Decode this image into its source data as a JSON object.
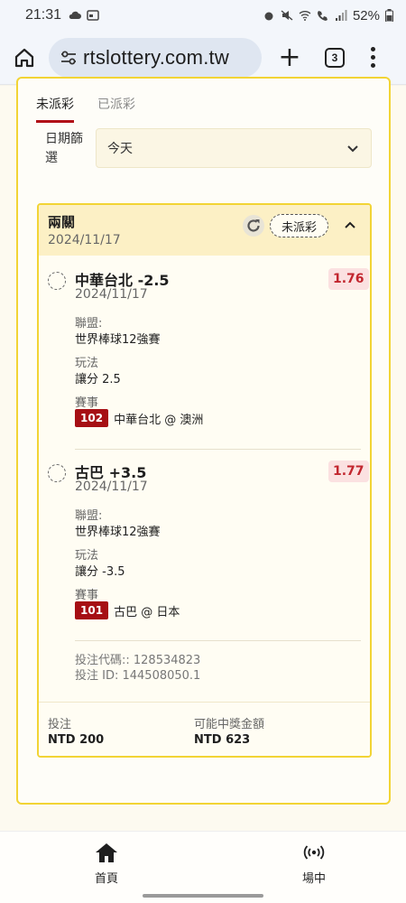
{
  "status_bar": {
    "time": "21:31",
    "battery": "52%"
  },
  "browser": {
    "url": "rtslottery.com.tw",
    "tab_count": "3"
  },
  "tabs": [
    {
      "label": "未派彩",
      "active": true
    },
    {
      "label": "已派彩",
      "active": false
    }
  ],
  "filter": {
    "label": "日期篩選",
    "value": "今天"
  },
  "bet": {
    "type": "兩關",
    "date": "2024/11/17",
    "status": "未派彩",
    "selections": [
      {
        "name": "中華台北 -2.5",
        "date": "2024/11/17",
        "odds": "1.76",
        "league_label": "聯盟:",
        "league": "世界棒球12強賽",
        "market_label": "玩法",
        "market": "讓分 2.5",
        "event_label": "賽事",
        "event_code": "102",
        "event": "中華台北 @ 澳洲"
      },
      {
        "name": "古巴 +3.5",
        "date": "2024/11/17",
        "odds": "1.77",
        "league_label": "聯盟:",
        "league": "世界棒球12強賽",
        "market_label": "玩法",
        "market": "讓分 -3.5",
        "event_label": "賽事",
        "event_code": "101",
        "event": "古巴 @ 日本"
      }
    ],
    "bet_code": "投注代碼:: 128534823",
    "bet_id": "投注 ID: 144508050.1",
    "stake_label": "投注",
    "stake": "NTD 200",
    "payout_label": "可能中獎金額",
    "payout": "NTD 623"
  },
  "bottom_nav": [
    {
      "label": "首頁",
      "icon": "home-icon"
    },
    {
      "label": "場中",
      "icon": "live-broadcast-icon"
    }
  ],
  "colors": {
    "accent_red": "#b10f17",
    "card_border": "#f2d435",
    "header_bg": "#fcf0c5",
    "odds_text": "#c2262e"
  }
}
